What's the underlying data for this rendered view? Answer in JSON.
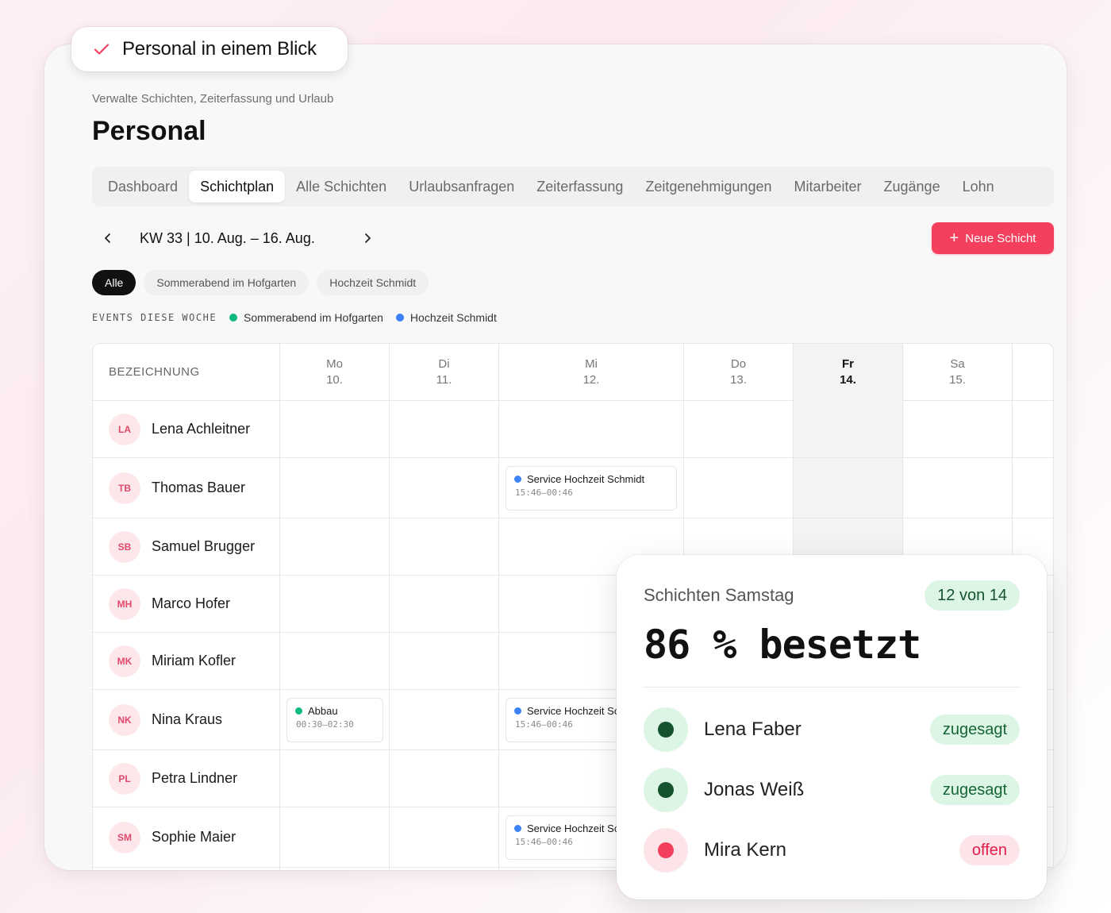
{
  "badge": {
    "text": "Personal in einem Blick"
  },
  "header": {
    "subtitle": "Verwalte Schichten, Zeiterfassung und Urlaub",
    "title": "Personal"
  },
  "tabs": [
    {
      "label": "Dashboard",
      "active": false
    },
    {
      "label": "Schichtplan",
      "active": true
    },
    {
      "label": "Alle Schichten",
      "active": false
    },
    {
      "label": "Urlaubsanfragen",
      "active": false
    },
    {
      "label": "Zeiterfassung",
      "active": false
    },
    {
      "label": "Zeitgenehmigungen",
      "active": false
    },
    {
      "label": "Mitarbeiter",
      "active": false
    },
    {
      "label": "Zugänge",
      "active": false
    },
    {
      "label": "Lohn",
      "active": false
    }
  ],
  "week": {
    "label": "KW 33 | 10. Aug. – 16. Aug.",
    "prev": "‹",
    "next": "›"
  },
  "new_shift": {
    "label": "Neue Schicht",
    "color": "#f43f5e"
  },
  "filters": [
    {
      "label": "Alle",
      "active": true
    },
    {
      "label": "Sommerabend im Hofgarten",
      "active": false
    },
    {
      "label": "Hochzeit Schmidt",
      "active": false
    }
  ],
  "events": {
    "label": "EVENTS DIESE WOCHE",
    "items": [
      {
        "name": "Sommerabend im Hofgarten",
        "color": "#10b981"
      },
      {
        "name": "Hochzeit Schmidt",
        "color": "#3b82f6"
      }
    ]
  },
  "grid": {
    "name_header": "BEZEICHNUNG",
    "days": [
      {
        "d": "Mo",
        "n": "10.",
        "today": false
      },
      {
        "d": "Di",
        "n": "11.",
        "today": false
      },
      {
        "d": "Mi",
        "n": "12.",
        "today": false
      },
      {
        "d": "Do",
        "n": "13.",
        "today": false
      },
      {
        "d": "Fr",
        "n": "14.",
        "today": true
      },
      {
        "d": "Sa",
        "n": "15.",
        "today": false
      },
      {
        "d": "",
        "n": "",
        "today": false
      }
    ],
    "employees": [
      {
        "initials": "LA",
        "name": "Lena Achleitner"
      },
      {
        "initials": "TB",
        "name": "Thomas Bauer"
      },
      {
        "initials": "SB",
        "name": "Samuel Brugger"
      },
      {
        "initials": "MH",
        "name": "Marco Hofer"
      },
      {
        "initials": "MK",
        "name": "Miriam Kofler"
      },
      {
        "initials": "NK",
        "name": "Nina Kraus"
      },
      {
        "initials": "PL",
        "name": "Petra Lindner"
      },
      {
        "initials": "SM",
        "name": "Sophie Maier"
      }
    ],
    "shifts": [
      {
        "row": 1,
        "day": 2,
        "title": "Service Hochzeit Schmidt",
        "time": "15:46–00:46",
        "color": "#3b82f6"
      },
      {
        "row": 5,
        "day": 0,
        "title": "Abbau",
        "time": "00:30–02:30",
        "color": "#10b981"
      },
      {
        "row": 5,
        "day": 2,
        "title": "Service Hochzeit Schmidt",
        "time": "15:46–00:46",
        "color": "#3b82f6"
      },
      {
        "row": 7,
        "day": 2,
        "title": "Service Hochzeit Schmidt",
        "time": "15:46–00:46",
        "color": "#3b82f6"
      }
    ]
  },
  "popup": {
    "title": "Schichten Samstag",
    "count": "12 von 14",
    "big": "86 % besetzt",
    "people": [
      {
        "name": "Lena Faber",
        "status": "zugesagt",
        "state": "yes"
      },
      {
        "name": "Jonas Weiß",
        "status": "zugesagt",
        "state": "yes"
      },
      {
        "name": "Mira Kern",
        "status": "offen",
        "state": "open"
      }
    ]
  }
}
